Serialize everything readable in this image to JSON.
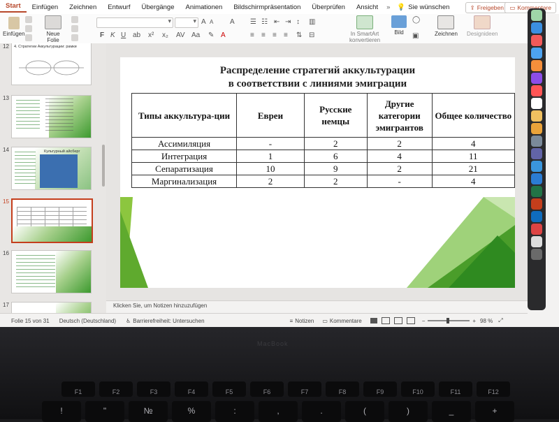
{
  "tabs": [
    "Start",
    "Einfügen",
    "Zeichnen",
    "Entwurf",
    "Übergänge",
    "Animationen",
    "Bildschirmpräsentation",
    "Überprüfen",
    "Ansicht"
  ],
  "tell_me": "Sie wünschen",
  "share_label": "Freigeben",
  "comments_label": "Kommentare",
  "ribbon": {
    "insert_label": "Einfügen",
    "new_slide_label": "Neue\nFolie",
    "smartart_label": "In SmartArt\nkonvertieren",
    "picture_label": "Bild",
    "draw_label": "Zeichnen",
    "designer_label": "Designideen"
  },
  "thumbnails": [
    {
      "num": "12",
      "title": "4. Стратегии Аккультурации: рамки"
    },
    {
      "num": "13",
      "title": ""
    },
    {
      "num": "14",
      "title": "Культурный айсберг"
    },
    {
      "num": "15",
      "title": ""
    },
    {
      "num": "16",
      "title": ""
    },
    {
      "num": "17",
      "title": ""
    }
  ],
  "slide": {
    "title_line1": "Распределение стратегий аккультурации",
    "title_line2": "в соответствии с линиями эмиграции",
    "headers": [
      "Типы аккультура-ции",
      "Евреи",
      "Русские немцы",
      "Другие категории эмигрантов",
      "Общее количество"
    ],
    "rows": [
      [
        "Ассимиляция",
        "-",
        "2",
        "2",
        "4"
      ],
      [
        "Интеграция",
        "1",
        "6",
        "4",
        "11"
      ],
      [
        "Сепаратизация",
        "10",
        "9",
        "2",
        "21"
      ],
      [
        "Маргинализация",
        "2",
        "2",
        "-",
        "4"
      ]
    ]
  },
  "notes_placeholder": "Klicken Sie, um Notizen hinzuzufügen",
  "status": {
    "slide_counter": "Folie 15 von 31",
    "language": "Deutsch (Deutschland)",
    "accessibility": "Barrierefreiheit: Untersuchen",
    "notes": "Notizen",
    "comments": "Kommentare",
    "zoom": "98 %"
  },
  "laptop_label": "MacBook",
  "keys_top": [
    "F1",
    "F2",
    "F3",
    "F4",
    "F5",
    "F6",
    "F7",
    "F8",
    "F9",
    "F10",
    "F11",
    "F12"
  ],
  "keys_row2": [
    "!",
    "\"",
    "№",
    "%",
    ":",
    ",",
    ".",
    "(",
    ")",
    "_",
    "+"
  ],
  "colors": {
    "accent": "#b7472a",
    "slide_green": "#3d9a2f"
  }
}
